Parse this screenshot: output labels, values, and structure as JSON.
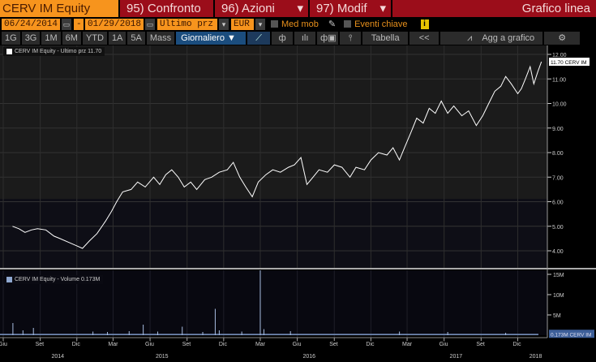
{
  "header": {
    "ticker": "CERV IM Equity",
    "compare": "95) Confronto",
    "actions": "96) Azioni",
    "edit": "97) Modif",
    "chart_type": "Grafico linea"
  },
  "controls": {
    "start_date": "06/24/2014",
    "dash": "-",
    "end_date": "01/29/2018",
    "field": "Ultimo prz",
    "currency": "EUR",
    "moving_avg": "Med mob",
    "key_events": "Eventi chiave",
    "info": "i"
  },
  "toolbar": {
    "periods": [
      "1G",
      "3G",
      "1M",
      "6M",
      "YTD",
      "1A",
      "5A",
      "Mass"
    ],
    "frequency": "Giornaliero ▼",
    "table": "Tabella",
    "collapse": "<<",
    "add_to_chart": "Agg a grafico",
    "settings": "⚙"
  },
  "colors": {
    "orange": "#f7941d",
    "red": "#9b0d1a",
    "line": "#ffffff"
  },
  "chart_data": [
    {
      "type": "line",
      "title": "CERV IM Equity - Ultimo prz 11.70",
      "last_label": "11.70 CERV IM",
      "ylim": [
        3.5,
        12.3
      ],
      "yticks": [
        "4.00",
        "5.00",
        "6.00",
        "7.00",
        "8.00",
        "9.00",
        "10.00",
        "11.00",
        "12.00"
      ],
      "points": [
        [
          "2014-06-24",
          5.0
        ],
        [
          "2014-07-10",
          4.9
        ],
        [
          "2014-07-25",
          4.75
        ],
        [
          "2014-08-10",
          4.85
        ],
        [
          "2014-08-25",
          4.9
        ],
        [
          "2014-09-15",
          4.85
        ],
        [
          "2014-10-05",
          4.6
        ],
        [
          "2014-10-20",
          4.5
        ],
        [
          "2014-11-10",
          4.35
        ],
        [
          "2014-12-01",
          4.2
        ],
        [
          "2014-12-15",
          4.1
        ],
        [
          "2015-01-01",
          4.4
        ],
        [
          "2015-01-20",
          4.7
        ],
        [
          "2015-02-10",
          5.2
        ],
        [
          "2015-02-25",
          5.6
        ],
        [
          "2015-03-10",
          6.0
        ],
        [
          "2015-03-25",
          6.4
        ],
        [
          "2015-04-15",
          6.5
        ],
        [
          "2015-05-01",
          6.8
        ],
        [
          "2015-05-20",
          6.6
        ],
        [
          "2015-06-10",
          7.0
        ],
        [
          "2015-06-25",
          6.7
        ],
        [
          "2015-07-10",
          7.1
        ],
        [
          "2015-07-25",
          7.3
        ],
        [
          "2015-08-10",
          7.0
        ],
        [
          "2015-08-25",
          6.6
        ],
        [
          "2015-09-10",
          6.8
        ],
        [
          "2015-09-25",
          6.5
        ],
        [
          "2015-10-15",
          6.9
        ],
        [
          "2015-11-01",
          7.0
        ],
        [
          "2015-11-20",
          7.2
        ],
        [
          "2015-12-10",
          7.3
        ],
        [
          "2015-12-25",
          7.6
        ],
        [
          "2016-01-10",
          7.0
        ],
        [
          "2016-01-25",
          6.6
        ],
        [
          "2016-02-10",
          6.2
        ],
        [
          "2016-02-25",
          6.8
        ],
        [
          "2016-03-15",
          7.1
        ],
        [
          "2016-04-01",
          7.3
        ],
        [
          "2016-04-20",
          7.2
        ],
        [
          "2016-05-10",
          7.4
        ],
        [
          "2016-05-25",
          7.5
        ],
        [
          "2016-06-10",
          7.8
        ],
        [
          "2016-06-25",
          6.7
        ],
        [
          "2016-07-10",
          7.0
        ],
        [
          "2016-07-25",
          7.3
        ],
        [
          "2016-08-15",
          7.2
        ],
        [
          "2016-09-01",
          7.5
        ],
        [
          "2016-09-20",
          7.4
        ],
        [
          "2016-10-10",
          7.0
        ],
        [
          "2016-10-25",
          7.4
        ],
        [
          "2016-11-15",
          7.3
        ],
        [
          "2016-12-01",
          7.7
        ],
        [
          "2016-12-20",
          8.0
        ],
        [
          "2017-01-10",
          7.9
        ],
        [
          "2017-01-25",
          8.2
        ],
        [
          "2017-02-10",
          7.7
        ],
        [
          "2017-02-25",
          8.3
        ],
        [
          "2017-03-10",
          8.8
        ],
        [
          "2017-03-25",
          9.4
        ],
        [
          "2017-04-10",
          9.2
        ],
        [
          "2017-04-25",
          9.8
        ],
        [
          "2017-05-10",
          9.6
        ],
        [
          "2017-05-25",
          10.1
        ],
        [
          "2017-06-10",
          9.6
        ],
        [
          "2017-06-25",
          9.9
        ],
        [
          "2017-07-15",
          9.5
        ],
        [
          "2017-08-01",
          9.7
        ],
        [
          "2017-08-20",
          9.1
        ],
        [
          "2017-09-05",
          9.5
        ],
        [
          "2017-09-20",
          10.0
        ],
        [
          "2017-10-05",
          10.5
        ],
        [
          "2017-10-20",
          10.7
        ],
        [
          "2017-11-01",
          11.1
        ],
        [
          "2017-11-15",
          10.8
        ],
        [
          "2017-12-01",
          10.4
        ],
        [
          "2017-12-10",
          10.6
        ],
        [
          "2017-12-20",
          11.0
        ],
        [
          "2018-01-01",
          11.5
        ],
        [
          "2018-01-10",
          10.8
        ],
        [
          "2018-01-20",
          11.3
        ],
        [
          "2018-01-29",
          11.7
        ]
      ]
    },
    {
      "type": "bar",
      "title": "CERV IM Equity - Volume 0.173M",
      "last_label": "0.173M CERV IM",
      "ylim": [
        0,
        16
      ],
      "yticks": [
        "5M",
        "10M",
        "15M"
      ],
      "spikes": [
        [
          "2014-06-25",
          3.0
        ],
        [
          "2014-07-20",
          1.2
        ],
        [
          "2014-08-15",
          1.8
        ],
        [
          "2015-01-10",
          0.9
        ],
        [
          "2015-02-15",
          0.8
        ],
        [
          "2015-04-10",
          1.0
        ],
        [
          "2015-05-15",
          2.6
        ],
        [
          "2015-06-20",
          0.9
        ],
        [
          "2015-08-20",
          2.1
        ],
        [
          "2015-10-10",
          0.8
        ],
        [
          "2015-11-10",
          6.5
        ],
        [
          "2015-11-20",
          1.2
        ],
        [
          "2016-01-15",
          0.9
        ],
        [
          "2016-03-01",
          16.0
        ],
        [
          "2016-03-10",
          1.5
        ],
        [
          "2016-05-15",
          1.0
        ],
        [
          "2017-02-10",
          0.9
        ],
        [
          "2017-06-10",
          0.8
        ],
        [
          "2017-11-01",
          0.6
        ]
      ],
      "base": 0.35
    },
    {
      "type": "axis",
      "months": [
        [
          "2014-06-01",
          "Giu"
        ],
        [
          "2014-09-01",
          "Set"
        ],
        [
          "2014-12-01",
          "Dic"
        ],
        [
          "2015-03-01",
          "Mar"
        ],
        [
          "2015-06-01",
          "Giu"
        ],
        [
          "2015-09-01",
          "Set"
        ],
        [
          "2015-12-01",
          "Dic"
        ],
        [
          "2016-03-01",
          "Mar"
        ],
        [
          "2016-06-01",
          "Giu"
        ],
        [
          "2016-09-01",
          "Set"
        ],
        [
          "2016-12-01",
          "Dic"
        ],
        [
          "2017-03-01",
          "Mar"
        ],
        [
          "2017-06-01",
          "Giu"
        ],
        [
          "2017-09-01",
          "Set"
        ],
        [
          "2017-12-01",
          "Dic"
        ]
      ],
      "years": [
        [
          "2014-10-15",
          "2014"
        ],
        [
          "2015-07-01",
          "2015"
        ],
        [
          "2016-07-01",
          "2016"
        ],
        [
          "2017-07-01",
          "2017"
        ],
        [
          "2018-01-15",
          "2018"
        ]
      ]
    }
  ]
}
